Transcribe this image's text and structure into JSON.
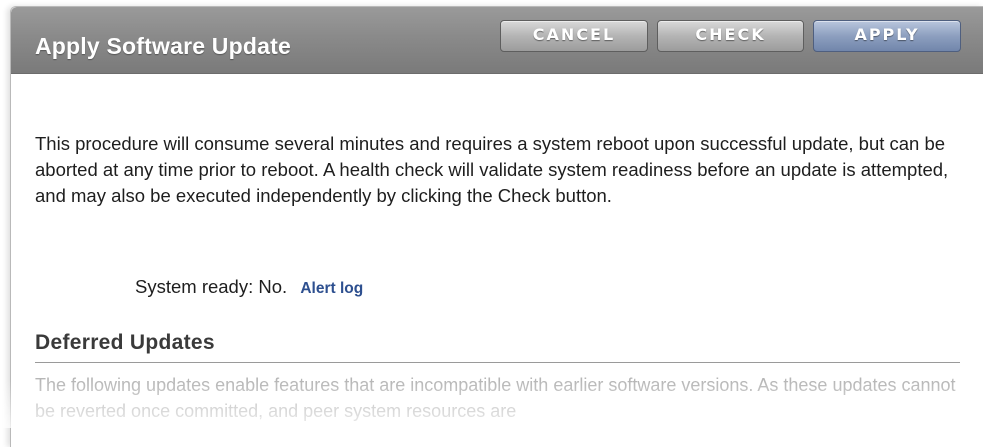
{
  "dialog": {
    "title": "Apply Software Update",
    "buttons": {
      "cancel": "CANCEL",
      "check": "CHECK",
      "apply": "APPLY"
    }
  },
  "content": {
    "description": "This procedure will consume several minutes and requires a system reboot upon successful update, but can be aborted at any time prior to reboot. A health check will validate system readiness before an update is attempted, and may also be executed independently by clicking the Check button.",
    "system_ready_label": "System ready:",
    "system_ready_value": "No.",
    "alert_log_link": "Alert log"
  },
  "deferred_updates": {
    "heading": "Deferred Updates",
    "text": "The following updates enable features that are incompatible with earlier software versions. As these updates cannot be reverted once committed, and peer system resources are"
  },
  "colors": {
    "titlebar": "#8a8a8a",
    "apply_button": "#8d9fbf",
    "link": "#2d4f8f"
  }
}
